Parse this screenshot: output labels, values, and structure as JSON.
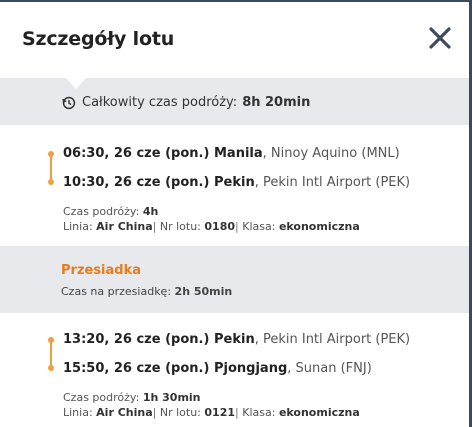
{
  "header": {
    "title": "Szczegóły lotu",
    "close_icon": "close-icon"
  },
  "total": {
    "label": "Całkowity czas podróży:",
    "value": "8h 20min",
    "icon": "clock-history-icon"
  },
  "segments": [
    {
      "departure": {
        "time": "06:30, 26 cze (pon.)",
        "city": "Manila",
        "airport": ", Ninoy Aquino (MNL)"
      },
      "arrival": {
        "time": "10:30, 26 cze (pon.)",
        "city": "Pekin",
        "airport": ", Pekin Intl Airport (PEK)"
      },
      "duration_label": "Czas podróży:",
      "duration": "4h",
      "airline_label": "Linia:",
      "airline": "Air China",
      "flight_label": "Nr lotu:",
      "flight": "0180",
      "class_label": "Klasa:",
      "class": "ekonomiczna"
    },
    {
      "departure": {
        "time": "13:20, 26 cze (pon.)",
        "city": "Pekin",
        "airport": ", Pekin Intl Airport (PEK)"
      },
      "arrival": {
        "time": "15:50, 26 cze (pon.)",
        "city": "Pjongjang",
        "airport": ", Sunan (FNJ)"
      },
      "duration_label": "Czas podróży:",
      "duration": "1h 30min",
      "airline_label": "Linia:",
      "airline": "Air China",
      "flight_label": "Nr lotu:",
      "flight": "0121",
      "class_label": "Klasa:",
      "class": "ekonomiczna"
    }
  ],
  "layover": {
    "title": "Przesiadka",
    "label": "Czas na przesiadkę:",
    "value": "2h 50min"
  },
  "colors": {
    "accent": "#f0a040",
    "layover_title": "#e87b1b",
    "band": "#e7e9ed",
    "backdrop": "#3a4a5e"
  }
}
